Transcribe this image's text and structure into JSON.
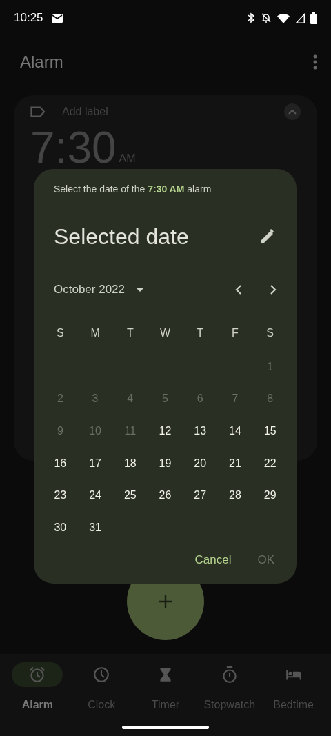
{
  "status_bar": {
    "time": "10:25"
  },
  "app_bar": {
    "title": "Alarm"
  },
  "alarm_card": {
    "label_placeholder": "Add label",
    "time": "7:30",
    "meridiem": "AM",
    "expanded": true
  },
  "dialog": {
    "prompt": "Select the date of the **7:30 AM** alarm",
    "headline": "Selected date",
    "month": "October 2022",
    "weekdays": [
      "S",
      "M",
      "T",
      "W",
      "T",
      "F",
      "S"
    ],
    "weeks": [
      {
        "kind": "end",
        "days": [
          {
            "label": "1",
            "disabled": true
          }
        ]
      },
      {
        "kind": "start",
        "days": [
          {
            "label": "2",
            "disabled": true
          },
          {
            "label": "3",
            "disabled": true
          },
          {
            "label": "4",
            "disabled": true
          },
          {
            "label": "5",
            "disabled": true
          },
          {
            "label": "6",
            "disabled": true
          },
          {
            "label": "7",
            "disabled": true
          },
          {
            "label": "8",
            "disabled": true
          }
        ]
      },
      {
        "kind": "start",
        "days": [
          {
            "label": "9",
            "disabled": true
          },
          {
            "label": "10",
            "disabled": true
          },
          {
            "label": "11",
            "disabled": true
          },
          {
            "label": "12",
            "disabled": false
          },
          {
            "label": "13",
            "disabled": false
          },
          {
            "label": "14",
            "disabled": false
          },
          {
            "label": "15",
            "disabled": false
          }
        ]
      },
      {
        "kind": "start",
        "days": [
          {
            "label": "16",
            "disabled": false
          },
          {
            "label": "17",
            "disabled": false
          },
          {
            "label": "18",
            "disabled": false
          },
          {
            "label": "19",
            "disabled": false
          },
          {
            "label": "20",
            "disabled": false
          },
          {
            "label": "21",
            "disabled": false
          },
          {
            "label": "22",
            "disabled": false
          }
        ]
      },
      {
        "kind": "start",
        "days": [
          {
            "label": "23",
            "disabled": false
          },
          {
            "label": "24",
            "disabled": false
          },
          {
            "label": "25",
            "disabled": false
          },
          {
            "label": "26",
            "disabled": false
          },
          {
            "label": "27",
            "disabled": false
          },
          {
            "label": "28",
            "disabled": false
          },
          {
            "label": "29",
            "disabled": false
          }
        ]
      },
      {
        "kind": "start",
        "days": [
          {
            "label": "30",
            "disabled": false
          },
          {
            "label": "31",
            "disabled": false
          }
        ]
      }
    ],
    "cancel": {
      "label": "Cancel",
      "disabled": false
    },
    "ok": {
      "label": "OK",
      "disabled": true
    }
  },
  "nav": [
    {
      "label": "Alarm",
      "kind": "alarm",
      "selected": true
    },
    {
      "label": "Clock",
      "kind": "clock",
      "selected": false
    },
    {
      "label": "Timer",
      "kind": "timer",
      "selected": false
    },
    {
      "label": "Stopwatch",
      "kind": "stopwatch",
      "selected": false
    },
    {
      "label": "Bedtime",
      "kind": "bedtime",
      "selected": false
    }
  ]
}
